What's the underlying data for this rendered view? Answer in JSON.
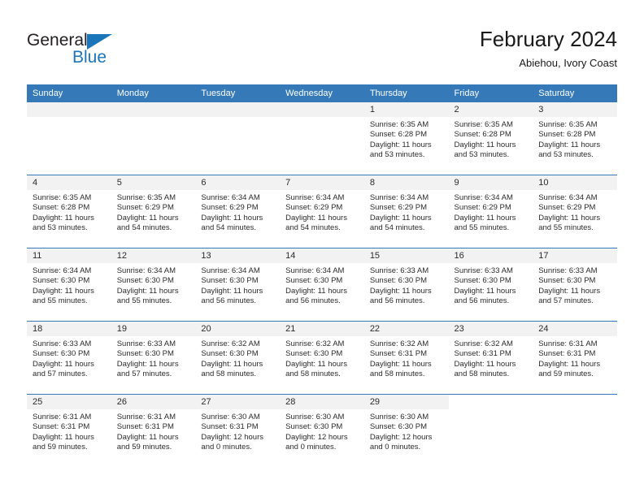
{
  "brand": {
    "name_part1": "General",
    "name_part2": "Blue",
    "accent_color": "#1b75bb"
  },
  "header": {
    "title": "February 2024",
    "subtitle": "Abiehou, Ivory Coast"
  },
  "calendar": {
    "header_bg": "#3579b8",
    "daynum_bg": "#f2f2f2",
    "weekday_headers": [
      "Sunday",
      "Monday",
      "Tuesday",
      "Wednesday",
      "Thursday",
      "Friday",
      "Saturday"
    ],
    "weeks": [
      [
        {
          "day": "",
          "lines": []
        },
        {
          "day": "",
          "lines": []
        },
        {
          "day": "",
          "lines": []
        },
        {
          "day": "",
          "lines": []
        },
        {
          "day": "1",
          "lines": [
            "Sunrise: 6:35 AM",
            "Sunset: 6:28 PM",
            "Daylight: 11 hours",
            "and 53 minutes."
          ]
        },
        {
          "day": "2",
          "lines": [
            "Sunrise: 6:35 AM",
            "Sunset: 6:28 PM",
            "Daylight: 11 hours",
            "and 53 minutes."
          ]
        },
        {
          "day": "3",
          "lines": [
            "Sunrise: 6:35 AM",
            "Sunset: 6:28 PM",
            "Daylight: 11 hours",
            "and 53 minutes."
          ]
        }
      ],
      [
        {
          "day": "4",
          "lines": [
            "Sunrise: 6:35 AM",
            "Sunset: 6:28 PM",
            "Daylight: 11 hours",
            "and 53 minutes."
          ]
        },
        {
          "day": "5",
          "lines": [
            "Sunrise: 6:35 AM",
            "Sunset: 6:29 PM",
            "Daylight: 11 hours",
            "and 54 minutes."
          ]
        },
        {
          "day": "6",
          "lines": [
            "Sunrise: 6:34 AM",
            "Sunset: 6:29 PM",
            "Daylight: 11 hours",
            "and 54 minutes."
          ]
        },
        {
          "day": "7",
          "lines": [
            "Sunrise: 6:34 AM",
            "Sunset: 6:29 PM",
            "Daylight: 11 hours",
            "and 54 minutes."
          ]
        },
        {
          "day": "8",
          "lines": [
            "Sunrise: 6:34 AM",
            "Sunset: 6:29 PM",
            "Daylight: 11 hours",
            "and 54 minutes."
          ]
        },
        {
          "day": "9",
          "lines": [
            "Sunrise: 6:34 AM",
            "Sunset: 6:29 PM",
            "Daylight: 11 hours",
            "and 55 minutes."
          ]
        },
        {
          "day": "10",
          "lines": [
            "Sunrise: 6:34 AM",
            "Sunset: 6:29 PM",
            "Daylight: 11 hours",
            "and 55 minutes."
          ]
        }
      ],
      [
        {
          "day": "11",
          "lines": [
            "Sunrise: 6:34 AM",
            "Sunset: 6:30 PM",
            "Daylight: 11 hours",
            "and 55 minutes."
          ]
        },
        {
          "day": "12",
          "lines": [
            "Sunrise: 6:34 AM",
            "Sunset: 6:30 PM",
            "Daylight: 11 hours",
            "and 55 minutes."
          ]
        },
        {
          "day": "13",
          "lines": [
            "Sunrise: 6:34 AM",
            "Sunset: 6:30 PM",
            "Daylight: 11 hours",
            "and 56 minutes."
          ]
        },
        {
          "day": "14",
          "lines": [
            "Sunrise: 6:34 AM",
            "Sunset: 6:30 PM",
            "Daylight: 11 hours",
            "and 56 minutes."
          ]
        },
        {
          "day": "15",
          "lines": [
            "Sunrise: 6:33 AM",
            "Sunset: 6:30 PM",
            "Daylight: 11 hours",
            "and 56 minutes."
          ]
        },
        {
          "day": "16",
          "lines": [
            "Sunrise: 6:33 AM",
            "Sunset: 6:30 PM",
            "Daylight: 11 hours",
            "and 56 minutes."
          ]
        },
        {
          "day": "17",
          "lines": [
            "Sunrise: 6:33 AM",
            "Sunset: 6:30 PM",
            "Daylight: 11 hours",
            "and 57 minutes."
          ]
        }
      ],
      [
        {
          "day": "18",
          "lines": [
            "Sunrise: 6:33 AM",
            "Sunset: 6:30 PM",
            "Daylight: 11 hours",
            "and 57 minutes."
          ]
        },
        {
          "day": "19",
          "lines": [
            "Sunrise: 6:33 AM",
            "Sunset: 6:30 PM",
            "Daylight: 11 hours",
            "and 57 minutes."
          ]
        },
        {
          "day": "20",
          "lines": [
            "Sunrise: 6:32 AM",
            "Sunset: 6:30 PM",
            "Daylight: 11 hours",
            "and 58 minutes."
          ]
        },
        {
          "day": "21",
          "lines": [
            "Sunrise: 6:32 AM",
            "Sunset: 6:30 PM",
            "Daylight: 11 hours",
            "and 58 minutes."
          ]
        },
        {
          "day": "22",
          "lines": [
            "Sunrise: 6:32 AM",
            "Sunset: 6:31 PM",
            "Daylight: 11 hours",
            "and 58 minutes."
          ]
        },
        {
          "day": "23",
          "lines": [
            "Sunrise: 6:32 AM",
            "Sunset: 6:31 PM",
            "Daylight: 11 hours",
            "and 58 minutes."
          ]
        },
        {
          "day": "24",
          "lines": [
            "Sunrise: 6:31 AM",
            "Sunset: 6:31 PM",
            "Daylight: 11 hours",
            "and 59 minutes."
          ]
        }
      ],
      [
        {
          "day": "25",
          "lines": [
            "Sunrise: 6:31 AM",
            "Sunset: 6:31 PM",
            "Daylight: 11 hours",
            "and 59 minutes."
          ]
        },
        {
          "day": "26",
          "lines": [
            "Sunrise: 6:31 AM",
            "Sunset: 6:31 PM",
            "Daylight: 11 hours",
            "and 59 minutes."
          ]
        },
        {
          "day": "27",
          "lines": [
            "Sunrise: 6:30 AM",
            "Sunset: 6:31 PM",
            "Daylight: 12 hours",
            "and 0 minutes."
          ]
        },
        {
          "day": "28",
          "lines": [
            "Sunrise: 6:30 AM",
            "Sunset: 6:30 PM",
            "Daylight: 12 hours",
            "and 0 minutes."
          ]
        },
        {
          "day": "29",
          "lines": [
            "Sunrise: 6:30 AM",
            "Sunset: 6:30 PM",
            "Daylight: 12 hours",
            "and 0 minutes."
          ]
        },
        {
          "day": "",
          "lines": []
        },
        {
          "day": "",
          "lines": []
        }
      ]
    ]
  }
}
